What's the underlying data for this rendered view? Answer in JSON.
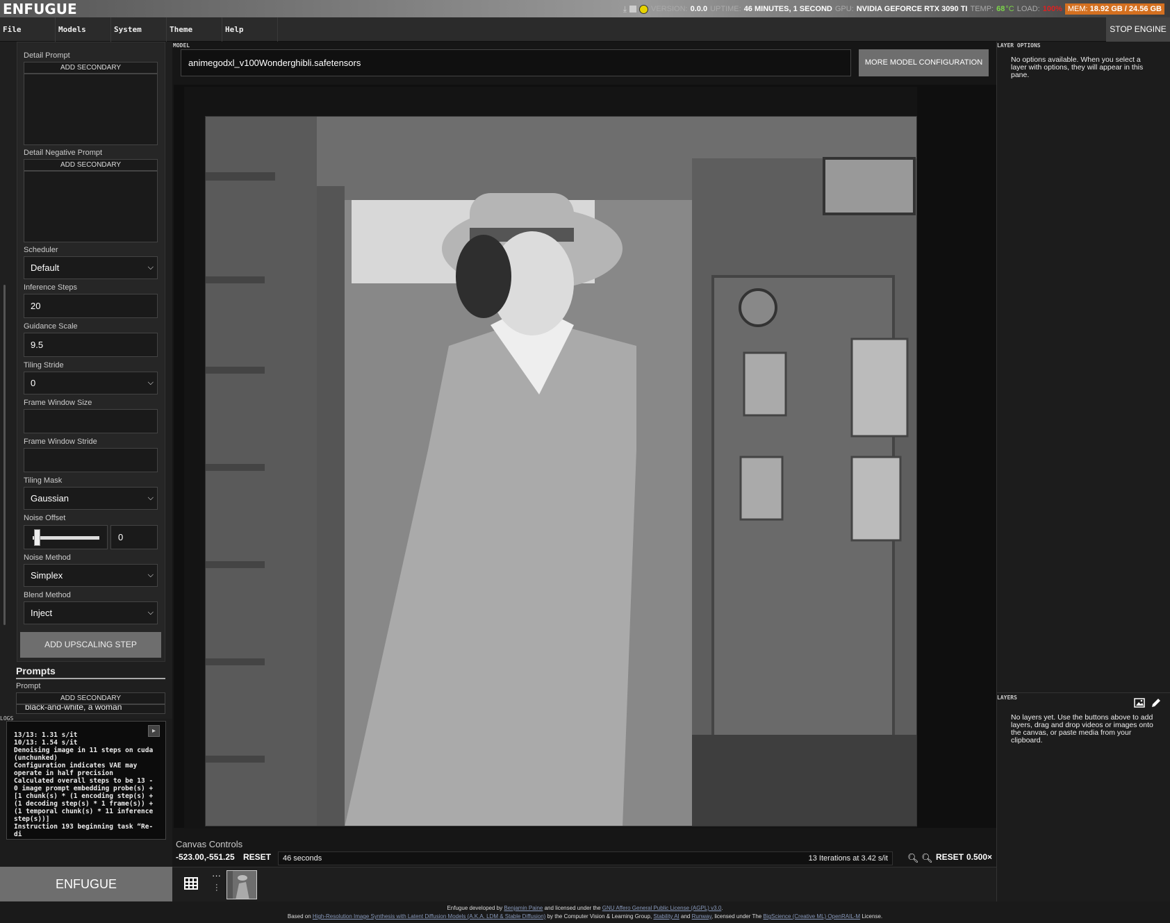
{
  "app": {
    "logo": "ENFUGUE"
  },
  "status": {
    "version_label": "VERSION:",
    "version": "0.0.0",
    "uptime_label": "UPTIME:",
    "uptime": "46 MINUTES, 1 SECOND",
    "gpu_label": "GPU:",
    "gpu": "NVIDIA GEFORCE RTX 3090 TI",
    "temp_label": "TEMP:",
    "temp": "68",
    "temp_unit": "°C",
    "load_label": "LOAD:",
    "load": "100%",
    "mem_label": "MEM:",
    "mem": "18.92 GB / 24.56 GB",
    "colors": {
      "indicator": "#e6d200",
      "temp": "#7cd64a",
      "load": "#e02020",
      "mem_bg": "#d47020"
    }
  },
  "menu": {
    "file": "File",
    "models": "Models",
    "system": "System",
    "theme": "Theme",
    "help": "Help",
    "stop_engine": "STOP ENGINE"
  },
  "left": {
    "detail_prompt": "Detail Prompt",
    "add_secondary": "ADD SECONDARY",
    "detail_negative_prompt": "Detail Negative Prompt",
    "scheduler_label": "Scheduler",
    "scheduler": "Default",
    "inference_steps_label": "Inference Steps",
    "inference_steps": "20",
    "guidance_scale_label": "Guidance Scale",
    "guidance_scale": "9.5",
    "tiling_stride_label": "Tiling Stride",
    "tiling_stride": "0",
    "frame_window_size_label": "Frame Window Size",
    "frame_window_size": "",
    "frame_window_stride_label": "Frame Window Stride",
    "frame_window_stride": "",
    "tiling_mask_label": "Tiling Mask",
    "tiling_mask": "Gaussian",
    "noise_offset_label": "Noise Offset",
    "noise_offset": "0",
    "noise_method_label": "Noise Method",
    "noise_method": "Simplex",
    "blend_method_label": "Blend Method",
    "blend_method": "Inject",
    "add_upscaling_step": "ADD UPSCALING STEP",
    "prompts_heading": "Prompts",
    "prompt_label": "Prompt",
    "prompt_value": "black-and-white, a woman"
  },
  "logs": {
    "label": "LOGS",
    "text": "13/13: 1.31 s/it\n10/13: 1.54 s/it\nDenoising image in 11 steps on cuda (unchunked)\nConfiguration indicates VAE may operate in half precision\nCalculated overall steps to be 13 - 0 image prompt embedding probe(s) + [1 chunk(s) * (1 encoding step(s) + (1 decoding step(s) * 1 frame(s)) + (1 temporal chunk(s) * 11 inference step(s))]\nInstruction 193 beginning task “Re-di"
  },
  "sidebar_button": "ENFUGUE",
  "model": {
    "label": "MODEL",
    "value": "animegodxl_v100Wonderghibli.safetensors",
    "more": "MORE MODEL CONFIGURATION"
  },
  "canvas": {
    "controls_heading": "Canvas Controls",
    "coords": "-523.00,-551.25",
    "reset": "RESET",
    "elapsed": "46 seconds",
    "iterations": "13 Iterations at 3.42 s/it",
    "zoom": "0.500×"
  },
  "right": {
    "layer_options_label": "LAYER OPTIONS",
    "layer_options_text": "No options available. When you select a layer with options, they will appear in this pane.",
    "layers_label": "LAYERS",
    "layers_text": "No layers yet. Use the buttons above to add layers, drag and drop videos or images onto the canvas, or paste media from your clipboard."
  },
  "footer": {
    "line1_a": "Enfugue developed by",
    "author": "Benjamin Paine",
    "line1_b": "and licensed under the",
    "license": "GNU Affero General Public License (AGPL) v3.0",
    "line2_a": "Based on",
    "paper": "High-Resolution Image Synthesis with Latent Diffusion Models (A.K.A. LDM & Stable Diffusion)",
    "line2_b": "by the Computer Vision & Learning Group,",
    "stability": "Stability AI",
    "and": "and",
    "runway": "Runway",
    "line2_c": ", licensed under The",
    "rail": "BigScience (Creative ML) OpenRAIL-M",
    "line2_d": "License."
  }
}
